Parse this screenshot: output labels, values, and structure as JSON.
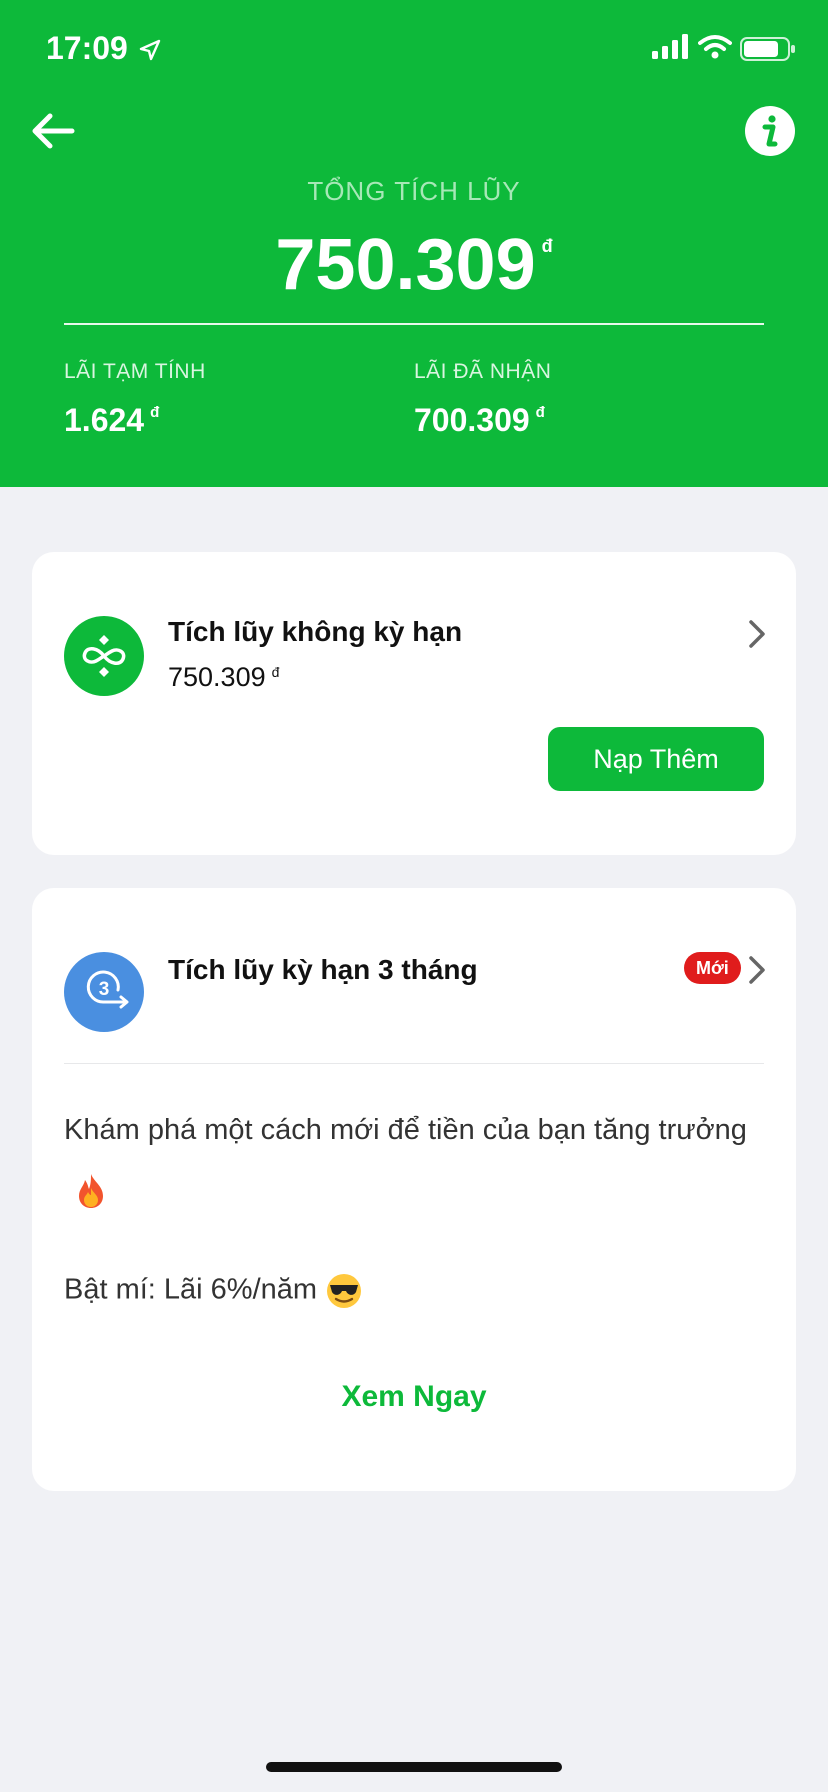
{
  "status_bar": {
    "time": "17:09"
  },
  "header": {
    "total_label": "TỔNG TÍCH LŨY",
    "total_amount": "750.309",
    "currency": "đ",
    "stats": [
      {
        "label": "LÃI TẠM TÍNH",
        "value": "1.624"
      },
      {
        "label": "LÃI ĐÃ NHẬN",
        "value": "700.309"
      }
    ]
  },
  "cards": [
    {
      "title": "Tích lũy không kỳ hạn",
      "amount": "750.309",
      "button": "Nạp Thêm"
    },
    {
      "title": "Tích lũy kỳ hạn 3 tháng",
      "badge": "Mới",
      "icon_number": "3",
      "promo_line1": "Khám phá một cách mới để tiền của bạn tăng trưởng",
      "promo_line2": "Bật mí: Lãi 6%/năm",
      "link": "Xem Ngay"
    }
  ],
  "colors": {
    "brand_green": "#0db93a",
    "badge_red": "#e01c1c",
    "term_blue": "#4a8fe0",
    "background": "#f0f1f5"
  },
  "icons": [
    "location-arrow-icon",
    "signal-icon",
    "wifi-icon",
    "battery-icon",
    "back-arrow-icon",
    "info-icon",
    "infinity-icon",
    "term-3-icon",
    "chevron-right-icon",
    "fire-emoji-icon",
    "sunglasses-emoji-icon"
  ]
}
